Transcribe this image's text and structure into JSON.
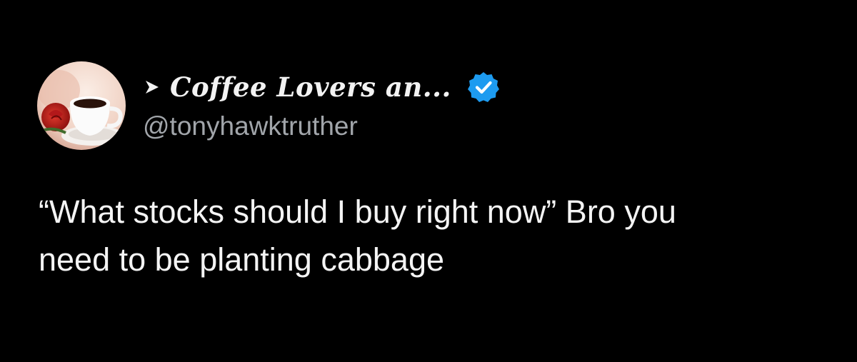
{
  "tweet": {
    "author": {
      "display_name": "Coffee Lovers an...",
      "handle": "@tonyhawktruther",
      "verified": true
    },
    "text_lines": [
      "“What stocks should I buy right now” Bro you",
      "need to be planting cabbage"
    ]
  },
  "colors": {
    "background": "#000000",
    "text_primary": "#f4f4f4",
    "text_secondary": "#a1a5aa",
    "verified_badge": "#1d9bf0"
  },
  "icons": {
    "avatar": "coffee-cup-with-rose",
    "name_prefix": "arrow-right-icon",
    "verified": "verified-badge-icon"
  }
}
